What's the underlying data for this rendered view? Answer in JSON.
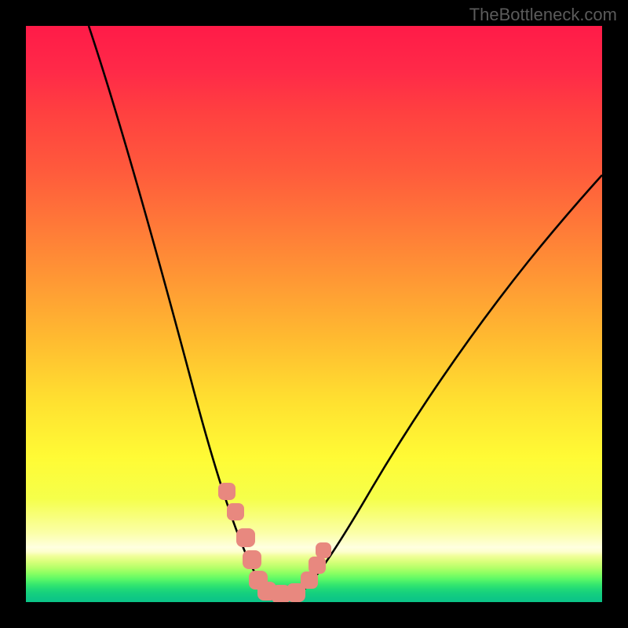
{
  "watermark": "TheBottleneck.com",
  "chart_data": {
    "type": "line",
    "title": "",
    "xlabel": "",
    "ylabel": "",
    "xlim": [
      0,
      100
    ],
    "ylim": [
      0,
      100
    ],
    "series": [
      {
        "name": "bottleneck-curve",
        "x": [
          11,
          15,
          18,
          21,
          24,
          26.5,
          29,
          31,
          33,
          34.5,
          35.8,
          37,
          38,
          39,
          39.8,
          40.5,
          41.2,
          42,
          43,
          44,
          45,
          46.5,
          48,
          50,
          52.5,
          55,
          58,
          62,
          66,
          71,
          76,
          82,
          88,
          95,
          100
        ],
        "values": [
          100,
          90,
          82,
          73,
          64,
          56,
          48,
          41,
          34,
          28,
          23,
          18,
          14,
          10,
          7,
          5,
          3.5,
          2.5,
          2,
          2,
          2.2,
          3,
          4.5,
          7,
          10,
          13.5,
          17.5,
          22.5,
          28,
          34,
          40,
          47,
          54,
          62,
          67
        ]
      }
    ],
    "markers": {
      "name": "highlighted-range",
      "color": "#e8887f",
      "points_x": [
        34.5,
        35.8,
        39,
        42.5,
        45.5,
        47,
        48.2
      ],
      "points_y": [
        17.5,
        14,
        3,
        2,
        3,
        5,
        8
      ]
    },
    "gradient_stops": [
      {
        "pos": 0,
        "color": "#ff1b48",
        "meaning": "severe-bottleneck"
      },
      {
        "pos": 50,
        "color": "#ffbd30",
        "meaning": "moderate"
      },
      {
        "pos": 80,
        "color": "#fffb35",
        "meaning": "mild"
      },
      {
        "pos": 100,
        "color": "#0bc488",
        "meaning": "no-bottleneck"
      }
    ]
  }
}
